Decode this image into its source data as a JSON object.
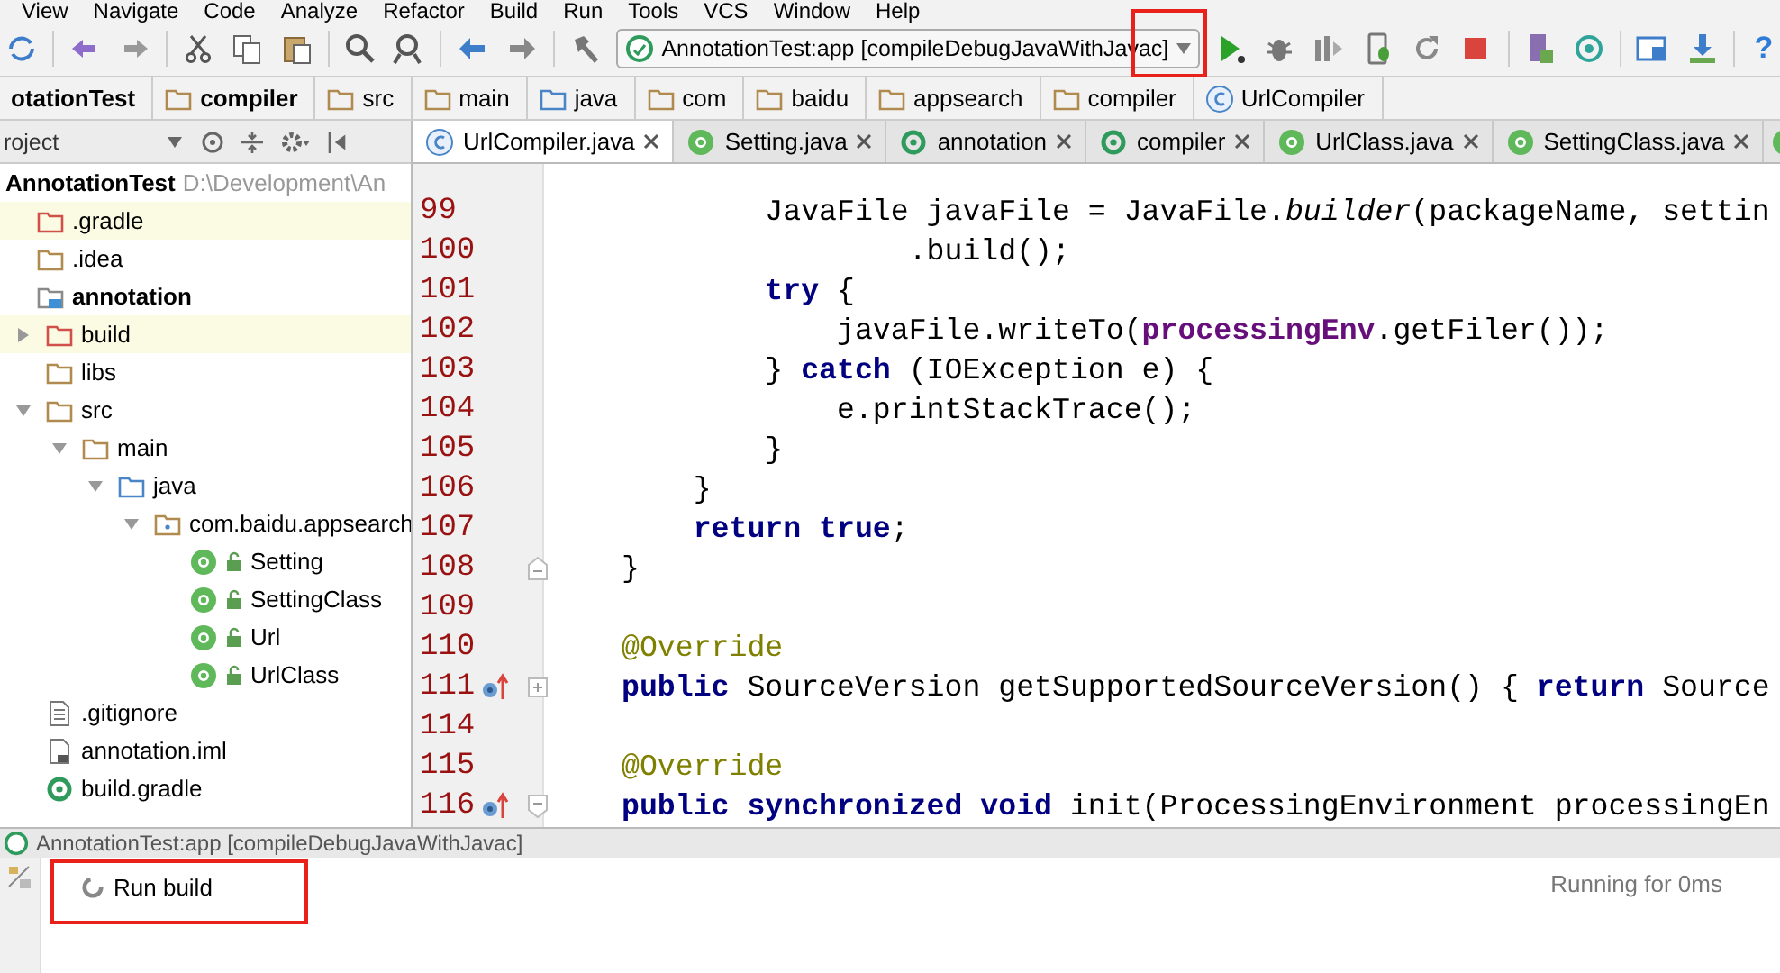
{
  "menu": [
    "View",
    "Navigate",
    "Code",
    "Analyze",
    "Refactor",
    "Build",
    "Run",
    "Tools",
    "VCS",
    "Window",
    "Help"
  ],
  "toolbar": {
    "run_config": "AnnotationTest:app [compileDebugJavaWithJavac]",
    "help": "?"
  },
  "breadcrumbs": [
    {
      "label": "otationTest",
      "bold": true
    },
    {
      "label": "compiler",
      "bold": true,
      "kind": "folder"
    },
    {
      "label": "src",
      "bold": false,
      "kind": "folder"
    },
    {
      "label": "main",
      "bold": false,
      "kind": "folder"
    },
    {
      "label": "java",
      "bold": false,
      "kind": "source-folder"
    },
    {
      "label": "com",
      "bold": false,
      "kind": "folder"
    },
    {
      "label": "baidu",
      "bold": false,
      "kind": "folder"
    },
    {
      "label": "appsearch",
      "bold": false,
      "kind": "folder"
    },
    {
      "label": "compiler",
      "bold": false,
      "kind": "folder"
    },
    {
      "label": "UrlCompiler",
      "bold": false,
      "kind": "class"
    }
  ],
  "project_panel": {
    "view": "roject",
    "root": {
      "label": "AnnotationTest",
      "path": "D:\\Development\\An"
    },
    "tree": [
      {
        "label": ".gradle",
        "kind": "folder-excluded",
        "highlighted": true,
        "bold": false
      },
      {
        "label": ".idea",
        "kind": "folder",
        "highlighted": false,
        "bold": false
      },
      {
        "label": "annotation",
        "kind": "module",
        "highlighted": false,
        "bold": true,
        "children": [
          {
            "label": "build",
            "kind": "folder-excluded",
            "highlighted": true,
            "bold": false,
            "expanded": false
          },
          {
            "label": "libs",
            "kind": "folder",
            "highlighted": false,
            "bold": false
          },
          {
            "label": "src",
            "kind": "folder",
            "highlighted": false,
            "bold": false,
            "expanded": true,
            "children": [
              {
                "label": "main",
                "kind": "folder",
                "highlighted": false,
                "bold": false,
                "expanded": true,
                "children": [
                  {
                    "label": "java",
                    "kind": "source-folder",
                    "highlighted": false,
                    "bold": false,
                    "expanded": true,
                    "children": [
                      {
                        "label": "com.baidu.appsearch",
                        "kind": "package",
                        "highlighted": false,
                        "bold": false,
                        "expanded": true,
                        "children": [
                          {
                            "label": "Setting",
                            "kind": "annotation",
                            "highlighted": false,
                            "bold": false
                          },
                          {
                            "label": "SettingClass",
                            "kind": "annotation",
                            "highlighted": false,
                            "bold": false
                          },
                          {
                            "label": "Url",
                            "kind": "annotation",
                            "highlighted": false,
                            "bold": false
                          },
                          {
                            "label": "UrlClass",
                            "kind": "annotation",
                            "highlighted": false,
                            "bold": false
                          }
                        ]
                      }
                    ]
                  }
                ]
              }
            ]
          },
          {
            "label": ".gitignore",
            "kind": "text-file",
            "highlighted": false,
            "bold": false
          },
          {
            "label": "annotation.iml",
            "kind": "iml-file",
            "highlighted": false,
            "bold": false
          },
          {
            "label": "build.gradle",
            "kind": "gradle",
            "highlighted": false,
            "bold": false
          }
        ]
      }
    ]
  },
  "editor_tabs": [
    {
      "label": "UrlCompiler.java",
      "kind": "class",
      "selected": true
    },
    {
      "label": "Setting.java",
      "kind": "annotation",
      "selected": false
    },
    {
      "label": "annotation",
      "kind": "gradle",
      "selected": false
    },
    {
      "label": "compiler",
      "kind": "gradle",
      "selected": false
    },
    {
      "label": "UrlClass.java",
      "kind": "annotation",
      "selected": false
    },
    {
      "label": "SettingClass.java",
      "kind": "annotation",
      "selected": false
    }
  ],
  "code": [
    {
      "number": "99",
      "tokens": [
        {
          "text": "        JavaFile javaFile = JavaFile.",
          "kind": "plain"
        },
        {
          "text": "builder",
          "kind": "static"
        },
        {
          "text": "(packageName, settin",
          "kind": "plain"
        }
      ]
    },
    {
      "number": "100",
      "tokens": [
        {
          "text": "                .build();",
          "kind": "plain"
        }
      ]
    },
    {
      "number": "101",
      "tokens": [
        {
          "text": "        try",
          "kind": "keyword"
        },
        {
          "text": " {",
          "kind": "plain"
        }
      ]
    },
    {
      "number": "102",
      "tokens": [
        {
          "text": "            javaFile.writeTo(",
          "kind": "plain"
        },
        {
          "text": "processingEnv",
          "kind": "field"
        },
        {
          "text": ".getFiler());",
          "kind": "plain"
        }
      ]
    },
    {
      "number": "103",
      "tokens": [
        {
          "text": "        } ",
          "kind": "plain"
        },
        {
          "text": "catch",
          "kind": "keyword"
        },
        {
          "text": " (IOException e) {",
          "kind": "plain"
        }
      ]
    },
    {
      "number": "104",
      "tokens": [
        {
          "text": "            e.printStackTrace();",
          "kind": "plain"
        }
      ]
    },
    {
      "number": "105",
      "tokens": [
        {
          "text": "        }",
          "kind": "plain"
        }
      ]
    },
    {
      "number": "106",
      "tokens": [
        {
          "text": "    }",
          "kind": "plain"
        }
      ]
    },
    {
      "number": "107",
      "tokens": [
        {
          "text": "    return true",
          "kind": "keyword"
        },
        {
          "text": ";",
          "kind": "plain"
        }
      ]
    },
    {
      "number": "108",
      "fold_end": true,
      "tokens": [
        {
          "text": "}",
          "kind": "plain"
        }
      ]
    },
    {
      "number": "109"
    },
    {
      "number": "110",
      "tokens": [
        {
          "text": "@Override",
          "kind": "annotation"
        }
      ]
    },
    {
      "number": "111",
      "overrides": true,
      "folded": true,
      "tokens": [
        {
          "text": "public",
          "kind": "keyword"
        },
        {
          "text": " SourceVersion getSupportedSourceVersion() { ",
          "kind": "plain"
        },
        {
          "text": "return",
          "kind": "keyword"
        },
        {
          "text": " Source",
          "kind": "plain"
        }
      ]
    },
    {
      "number": "114"
    },
    {
      "number": "115",
      "tokens": [
        {
          "text": "@Override",
          "kind": "annotation"
        }
      ]
    },
    {
      "number": "116",
      "overrides": true,
      "fold_start": true,
      "tokens": [
        {
          "text": "public synchronized void",
          "kind": "keyword"
        },
        {
          "text": " init(ProcessingEnvironment processingEn",
          "kind": "plain"
        }
      ]
    }
  ],
  "build_panel": {
    "title": "AnnotationTest:app [compileDebugJavaWithJavac]",
    "task": "Run build",
    "status": "Running for 0ms"
  }
}
